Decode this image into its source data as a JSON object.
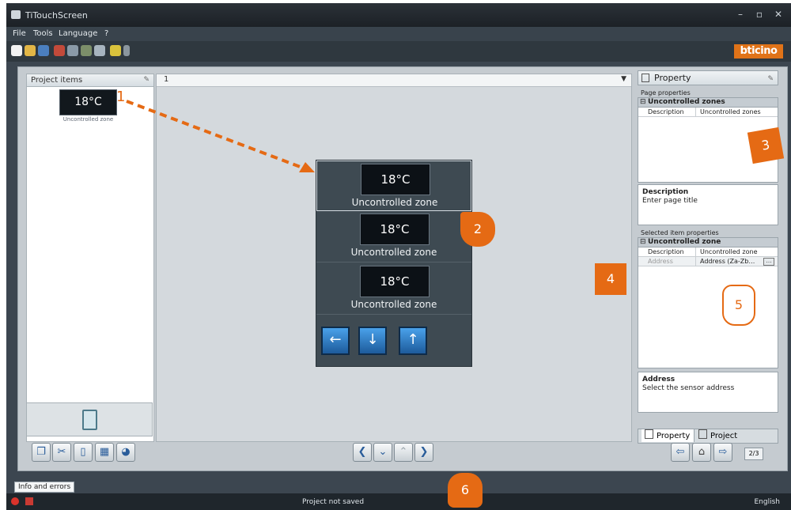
{
  "window": {
    "title": "TiTouchScreen"
  },
  "menu": [
    "File",
    "Tools",
    "Language",
    "?"
  ],
  "brand": "bticino",
  "project_items": {
    "header": "Project items",
    "thumb_temp": "18°C",
    "thumb_caption": "Uncontrolled zone"
  },
  "page_selector": {
    "value": "1"
  },
  "zones": [
    {
      "temp": "18°C",
      "label": "Uncontrolled zone"
    },
    {
      "temp": "18°C",
      "label": "Uncontrolled zone"
    },
    {
      "temp": "18°C",
      "label": "Uncontrolled zone"
    }
  ],
  "property_panel": {
    "header": "Property",
    "page_properties_label": "Page properties",
    "page_group": "Uncontrolled zones",
    "page_desc_key": "Description",
    "page_desc_value": "Uncontrolled zones",
    "description_title": "Description",
    "description_text": "Enter page title",
    "selected_label": "Selected item properties",
    "selected_group": "Uncontrolled zone",
    "sel_desc_key": "Description",
    "sel_desc_value": "Uncontrolled zone",
    "sel_addr_key": "Address",
    "sel_addr_value": "Address (Za-Zb…",
    "address_title": "Address",
    "address_text": "Select the sensor address",
    "tab_property": "Property",
    "tab_project": "Project"
  },
  "page_counter": "2/3",
  "info_tab": "Info and errors",
  "status": {
    "text": "Project not saved",
    "language": "English"
  },
  "callouts": [
    "1",
    "2",
    "3",
    "4",
    "5",
    "6"
  ],
  "colors": {
    "accent": "#e56a14",
    "nav_blue": "#2b7fd0"
  }
}
